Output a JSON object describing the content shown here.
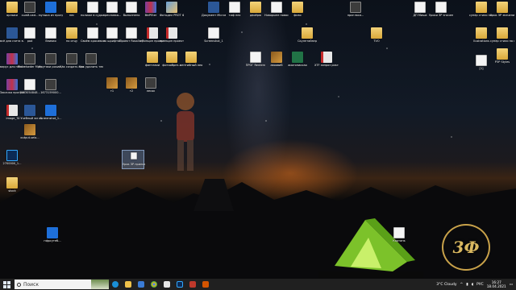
{
  "desktop": {
    "col1": [
      "ярлыки",
      "всё для счета в...",
      "вирус для папка",
      "Закачка программы",
      "image_7",
      "2700000_1...",
      "stock"
    ],
    "col2": [
      "сшей-сам...",
      "pad",
      "Plot elseder Мрепт",
      "1583054848...",
      "4 Учебный эм котлс...",
      "output-selo..."
    ],
    "col3": [
      "музыка из програми",
      "Впивая",
      "Крутяки рокио / пес...",
      "1673159000...",
      "Screenshot_1..."
    ],
    "col4": [
      "пес",
      "по отцу",
      "Как создать проект...",
      "Как удалить текст / ч..."
    ],
    "col5": [
      "нолиже в судол сао...",
      "Своём красивом...",
      "т1"
    ],
    "col6": [
      "пресловка...",
      "по шрифтах",
      "т2"
    ],
    "col7": [
      "Выполнено",
      "Проект Rosalia P...",
      "лесок"
    ],
    "col8": [
      "BkiPEter",
      "принцип проекта",
      "фантазии"
    ],
    "col9": [
      "Фотодел PROT Фото...",
      "принцип проекта",
      "фотообрез...",
      "ментийный лео"
    ],
    "col10": [
      "Документ Microsoft...",
      "Screenshot_1"
    ],
    "col11": [
      "тиф пех"
    ],
    "col12": [
      "двоёрю"
    ],
    "col13": [
      "Новорыне новос 1..."
    ],
    "col14": [
      "физо",
      "Скулптайзер"
    ],
    "col15": [
      "ПРОГ Rentern",
      "авоовиб",
      "аиогопиисао",
      "XTF запроз рикгон..."
    ],
    "col16": [
      "пригласи...",
      "TVO"
    ],
    "col17": [
      "ПЗ Grafo"
    ],
    "col18": [
      "ЕГЭ; файл"
    ],
    "right": [
      "ДП Миша",
      "Уроки ЗР значения...",
      "супер стили на фото",
      "Урок ЗР значения",
      "Ilustrations",
      "супер стили на фото",
      "P3P Styles",
      "[1]"
    ],
    "selected_icon": "Урок ЗР приложения...",
    "bottom_left": "пфрсутеб...",
    "bottom_right": "Картинк",
    "emblem_text": "3Ф"
  },
  "taskbar": {
    "search_placeholder": "Поиск",
    "weather": "3°C  Cloudy",
    "language": "РУС",
    "time": "16:27",
    "date": "18.04.2021"
  }
}
